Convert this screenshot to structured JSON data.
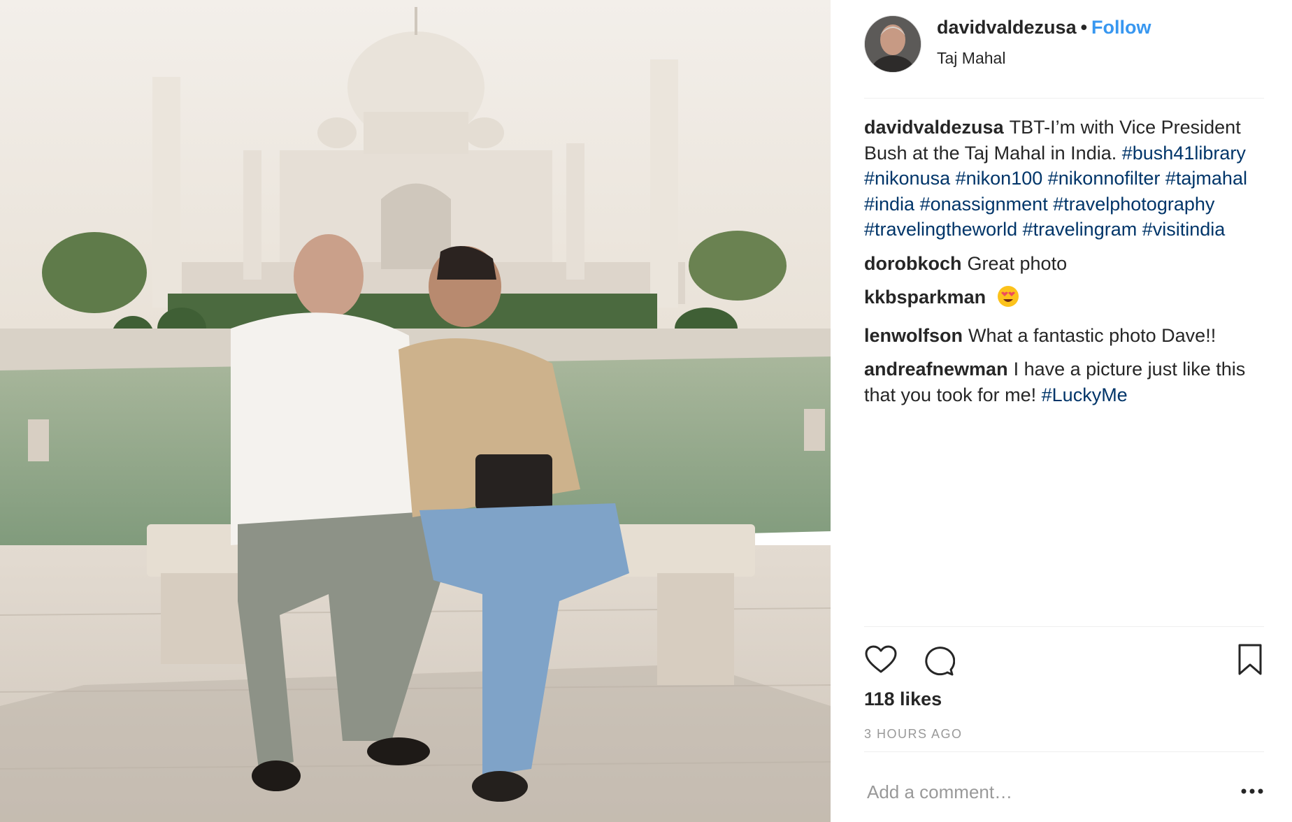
{
  "post": {
    "image_alt": "Two men seated on a marble bench in front of the Taj Mahal"
  },
  "header": {
    "username": "davidvaldezusa",
    "separator": "•",
    "follow_label": "Follow",
    "location": "Taj Mahal"
  },
  "caption": {
    "username": "davidvaldezusa",
    "text": "TBT-I’m with Vice President Bush at the Taj Mahal in India.",
    "hashtags": [
      "#bush41library",
      "#nikonusa",
      "#nikon100",
      "#nikonnofilter",
      "#tajmahal",
      "#india",
      "#onassignment",
      "#travelphotography",
      "#travelingtheworld",
      "#travelingram",
      "#visitindia"
    ]
  },
  "comments": [
    {
      "username": "dorobkoch",
      "text": "Great photo"
    },
    {
      "username": "kkbsparkman",
      "text": "",
      "emoji": "heart-eyes"
    },
    {
      "username": "lenwolfson",
      "text": "What a fantastic photo Dave!!"
    },
    {
      "username": "andreafnewman",
      "text": "I have a picture just like this that you took for me! ",
      "hashtag": "#LuckyMe"
    }
  ],
  "actions": {
    "like_icon": "heart-outline-icon",
    "comment_icon": "speech-bubble-icon",
    "save_icon": "bookmark-icon"
  },
  "likes": "118 likes",
  "timestamp": "3 HOURS AGO",
  "add_comment": {
    "placeholder": "Add a comment…",
    "more_icon": "ellipsis-icon"
  },
  "colors": {
    "link": "#3897f0",
    "hashtag": "#003569",
    "muted": "#999999",
    "text": "#262626",
    "divider": "#efefef"
  }
}
